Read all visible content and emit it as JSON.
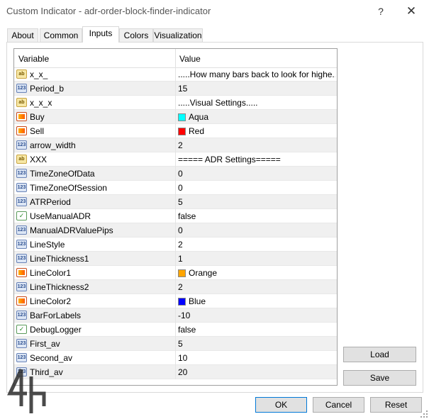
{
  "window": {
    "title": "Custom Indicator - adr-order-block-finder-indicator",
    "help_label": "?",
    "close_label": "✕"
  },
  "tabs": [
    "About",
    "Common",
    "Inputs",
    "Colors",
    "Visualization"
  ],
  "active_tab": "Inputs",
  "table": {
    "headers": [
      "Variable",
      "Value"
    ],
    "rows": [
      {
        "icon": "string-type-icon",
        "name": "x_x_",
        "value": ".....How many bars back to look for highe..."
      },
      {
        "icon": "integer-type-icon",
        "name": "Period_b",
        "value": "15"
      },
      {
        "icon": "string-type-icon",
        "name": "x_x_x",
        "value": ".....Visual Settings....."
      },
      {
        "icon": "color-type-icon",
        "name": "Buy",
        "value": "Aqua",
        "color": "#00ffff"
      },
      {
        "icon": "color-type-icon",
        "name": "Sell",
        "value": "Red",
        "color": "#ff0000"
      },
      {
        "icon": "integer-type-icon",
        "name": "arrow_width",
        "value": "2"
      },
      {
        "icon": "string-type-icon",
        "name": "XXX",
        "value": "===== ADR Settings====="
      },
      {
        "icon": "integer-type-icon",
        "name": "TimeZoneOfData",
        "value": "0"
      },
      {
        "icon": "integer-type-icon",
        "name": "TimeZoneOfSession",
        "value": "0"
      },
      {
        "icon": "integer-type-icon",
        "name": "ATRPeriod",
        "value": "5"
      },
      {
        "icon": "boolean-type-icon",
        "name": "UseManualADR",
        "value": "false"
      },
      {
        "icon": "integer-type-icon",
        "name": "ManualADRValuePips",
        "value": "0"
      },
      {
        "icon": "integer-type-icon",
        "name": "LineStyle",
        "value": "2"
      },
      {
        "icon": "integer-type-icon",
        "name": "LineThickness1",
        "value": "1"
      },
      {
        "icon": "color-type-icon",
        "name": "LineColor1",
        "value": "Orange",
        "color": "#ffa500"
      },
      {
        "icon": "integer-type-icon",
        "name": "LineThickness2",
        "value": "2"
      },
      {
        "icon": "color-type-icon",
        "name": "LineColor2",
        "value": "Blue",
        "color": "#0000ff"
      },
      {
        "icon": "integer-type-icon",
        "name": "BarForLabels",
        "value": "-10"
      },
      {
        "icon": "boolean-type-icon",
        "name": "DebugLogger",
        "value": "false"
      },
      {
        "icon": "integer-type-icon",
        "name": "First_av",
        "value": "5"
      },
      {
        "icon": "integer-type-icon",
        "name": "Second_av",
        "value": "10"
      },
      {
        "icon": "integer-type-icon",
        "name": "Third_av",
        "value": "20"
      }
    ]
  },
  "buttons": {
    "load": "Load",
    "save": "Save",
    "ok": "OK",
    "cancel": "Cancel",
    "reset": "Reset"
  },
  "colors": {
    "accent": "#0078d7",
    "row_alt": "#f0f0f0"
  }
}
